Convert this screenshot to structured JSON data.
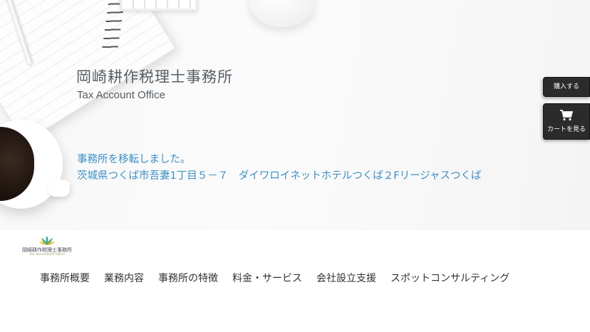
{
  "hero": {
    "title": "岡崎耕作税理士事務所",
    "subtitle": "Tax Account Office",
    "notice_line1": "事務所を移転しました。",
    "notice_line2": "茨城県つくば市吾妻1丁目５－７　ダイワロイネットホテルつくば２Fリージャスつくば"
  },
  "floating": {
    "buy_label": "購入する",
    "cart_label": "カートを見る",
    "cart_icon": "cart-icon"
  },
  "logo": {
    "text": "岡崎耕作税理士事務所",
    "sub": "Tax Accountant Office",
    "icon": "lotus-icon",
    "colors": {
      "green": "#6aa84f",
      "teal": "#2aa6b8",
      "yellow": "#e8c53a"
    }
  },
  "nav": {
    "items": [
      {
        "label": "事務所概要"
      },
      {
        "label": "業務内容"
      },
      {
        "label": "事務所の特徴"
      },
      {
        "label": "料金・サービス"
      },
      {
        "label": "会社設立支援"
      },
      {
        "label": "スポットコンサルティング"
      }
    ]
  },
  "colors": {
    "notice_text": "#3a8fc8",
    "title_text": "#555f66",
    "button_bg": "#2b2b2b"
  }
}
